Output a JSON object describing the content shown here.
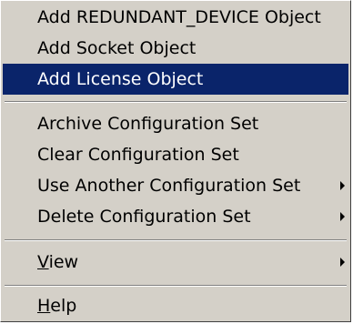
{
  "menu": {
    "items": [
      {
        "label": "Add REDUNDANT_DEVICE Object"
      },
      {
        "label": "Add Socket Object"
      },
      {
        "label": "Add License Object",
        "selected": true
      },
      {
        "label": "Archive Configuration Set"
      },
      {
        "label": "Clear Configuration Set"
      },
      {
        "label": "Use Another Configuration Set",
        "submenu": true
      },
      {
        "label": "Delete Configuration Set",
        "submenu": true
      },
      {
        "label_mnemonic": "V",
        "label_rest": "iew",
        "submenu": true
      },
      {
        "label_mnemonic": "H",
        "label_rest": "elp"
      }
    ]
  },
  "colors": {
    "menu_bg": "#d4d0c8",
    "highlight_bg": "#0a246a",
    "highlight_text": "#ffffff"
  }
}
